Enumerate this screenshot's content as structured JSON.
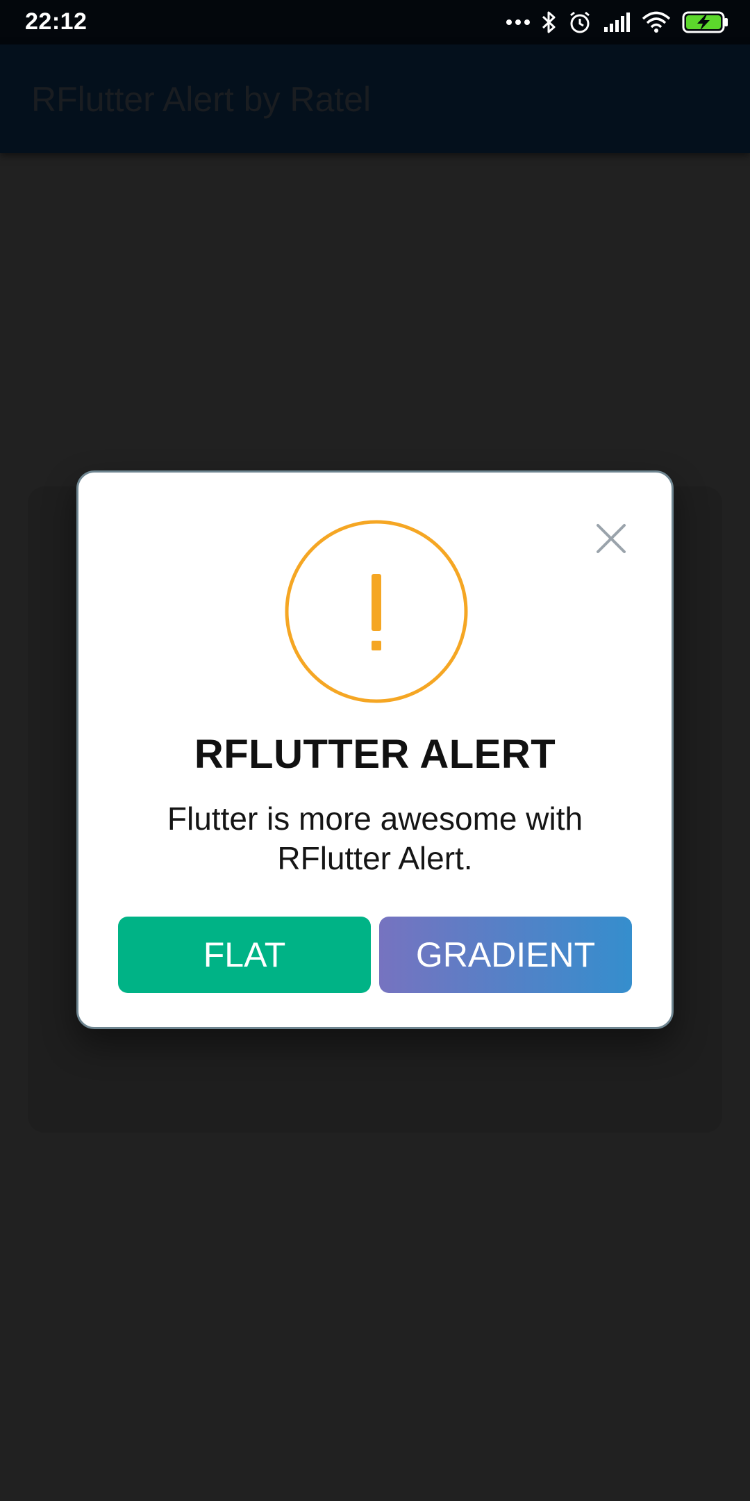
{
  "status_bar": {
    "time": "22:12",
    "icons": [
      "more-dots-icon",
      "bluetooth-icon",
      "alarm-icon",
      "signal-icon",
      "wifi-icon",
      "battery-charging-icon"
    ],
    "battery_color": "#5cd72c"
  },
  "app_bar": {
    "title": "RFlutter Alert by Ratel"
  },
  "dialog": {
    "icon": "warning-icon",
    "icon_color": "#f5a623",
    "icon_glyph": "!",
    "title": "RFLUTTER ALERT",
    "description": "Flutter is more awesome with RFlutter Alert.",
    "close_icon": "close-icon",
    "buttons": [
      {
        "label": "FLAT",
        "color": "#00b386"
      },
      {
        "label": "GRADIENT",
        "gradient_start": "#7673c0",
        "gradient_end": "#358ecd"
      }
    ]
  }
}
